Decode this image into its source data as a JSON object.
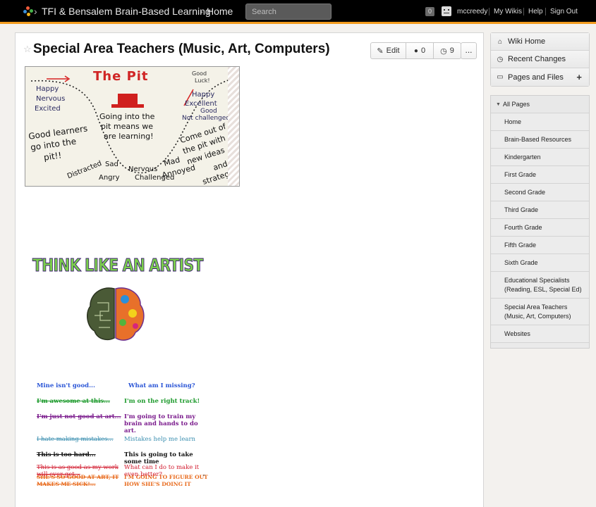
{
  "header": {
    "breadcrumb": [
      "TFI & Bensalem Brain-Based Learning",
      "Home"
    ],
    "search_placeholder": "Search",
    "notifications": "0",
    "username": "mccreedy",
    "links": [
      "My Wikis",
      "Help",
      "Sign Out"
    ],
    "accent_color": "#f29b1e"
  },
  "page": {
    "title": "Special Area Teachers (Music, Art, Computers)",
    "actions": {
      "edit_label": "Edit",
      "comments_count": "0",
      "history_count": "9",
      "more_label": "..."
    },
    "images": {
      "pit": {
        "heading": "The Pit",
        "left_top": [
          "Happy",
          "Nervous",
          "Excited"
        ],
        "left_mid": [
          "Good learners",
          "go into the",
          "pit!!"
        ],
        "center": [
          "Going into the",
          "pit means we",
          "are learning!"
        ],
        "right_top": [
          "Good",
          "Luck!"
        ],
        "right_upper": [
          "Happy",
          "Excellent",
          "Good",
          "Not challenged"
        ],
        "right_mid": [
          "Come out of",
          "the pit with",
          "new ideas",
          "and",
          "strategies!"
        ],
        "bottom": [
          "Distracted",
          "Sad",
          "Angry",
          "Nervous",
          "Challenged",
          "Mad",
          "Annoyed"
        ]
      },
      "artist": {
        "heading": "THINK LIKE AN ARTIST",
        "rows": [
          {
            "fixed": "Mine isn't good...",
            "growth": "What am I missing?",
            "color": "#2a55d6"
          },
          {
            "fixed": "I'm awesome at this...",
            "growth": "I'm on the right track!",
            "color": "#1d9a2c"
          },
          {
            "fixed": "I'm just not good at art...",
            "growth": "I'm going to train my brain and hands to do art.",
            "color": "#7a1a8c"
          },
          {
            "fixed": "I hate making mistakes...",
            "growth": "Mistakes help me learn",
            "color": "#3b8fb0"
          },
          {
            "fixed": "This is too hard...",
            "growth": "This is going to take some time",
            "color": "#111111"
          },
          {
            "fixed": "SHE'S SO GOOD AT ART, IT MAKES ME SICK!...",
            "growth": "I'M GOING TO FIGURE OUT HOW SHE'S DOING IT",
            "color": "#e86a1c"
          },
          {
            "fixed": "This is as good as my work will ever get...",
            "growth": "What can I do to make it even better?",
            "color": "#d21b2e"
          }
        ],
        "trailing_mark": "\""
      }
    }
  },
  "sidebar": {
    "top_links": [
      "Wiki Home",
      "Recent Changes",
      "Pages and Files"
    ],
    "all_pages_label": "All Pages",
    "pages": [
      "Home",
      "Brain-Based Resources",
      "Kindergarten",
      "First Grade",
      "Second Grade",
      "Third Grade",
      "Fourth Grade",
      "Fifth Grade",
      "Sixth Grade",
      "Educational Specialists (Reading, ESL, Special Ed)",
      "Special Area Teachers (Music, Art, Computers)",
      "Websites"
    ]
  }
}
